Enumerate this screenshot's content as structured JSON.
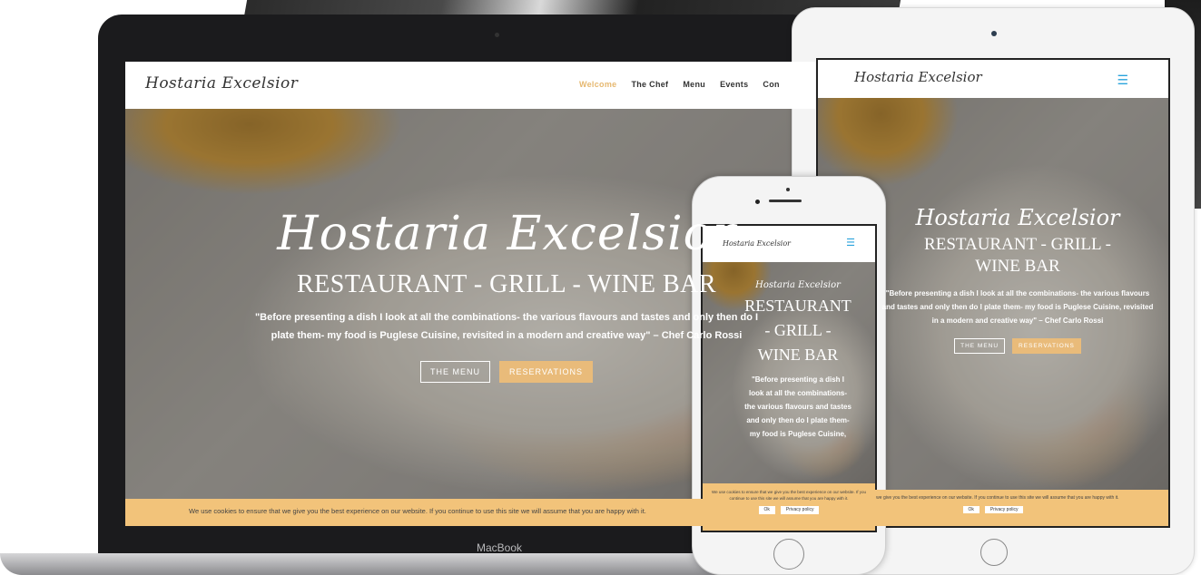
{
  "site": {
    "logo": "Hostaria Excelsior",
    "hero_title": "Hostaria Excelsior",
    "tagline": "RESTAURANT - GRILL - WINE BAR",
    "tagline_phone": [
      "RESTAURANT",
      "- GRILL -",
      "WINE BAR"
    ],
    "tagline_tablet": [
      "RESTAURANT - GRILL -",
      "WINE BAR"
    ],
    "quote_laptop": "\"Before presenting a dish I look at all the combinations- the various flavours and tastes and only then do I plate them- my food is Puglese Cuisine, revisited in a modern and creative way\" – Chef Carlo Rossi",
    "quote_tablet": "\"Before presenting a dish I look at all the combinations- the various flavours and tastes and only then do I plate them- my food is Puglese Cuisine, revisited in a modern and creative way\" – Chef Carlo Rossi",
    "quote_phone": "\"Before presenting a dish I look at all the combinations- the various flavours and tastes and only then do I plate them- my food is Puglese Cuisine,",
    "buttons": {
      "menu": "THE MENU",
      "reservations": "RESERVATIONS"
    },
    "nav": {
      "welcome": "Welcome",
      "chef": "The Chef",
      "menu": "Menu",
      "events": "Events",
      "contact": "Con"
    },
    "cookie_laptop": "We use cookies to ensure that we give you the best experience on our website. If you continue to use this site we will assume that you are happy with it.",
    "cookie_tablet": "that we give you the best experience on our website. If you continue to use this site we will assume that you are happy with it.",
    "cookie_phone": "We use cookies to ensure that we give you the best experience on our website. If you continue to use this site we will assume that you are happy with it.",
    "cookie_ok": "Ok",
    "cookie_privacy": "Privacy policy"
  },
  "device": {
    "laptop_label": "MacBook"
  },
  "icons": {
    "menu": "hamburger-icon"
  },
  "colors": {
    "accent_gold": "#e9bb7a",
    "cookie_bar": "#f2c37a",
    "burger": "#2aa3dc"
  }
}
